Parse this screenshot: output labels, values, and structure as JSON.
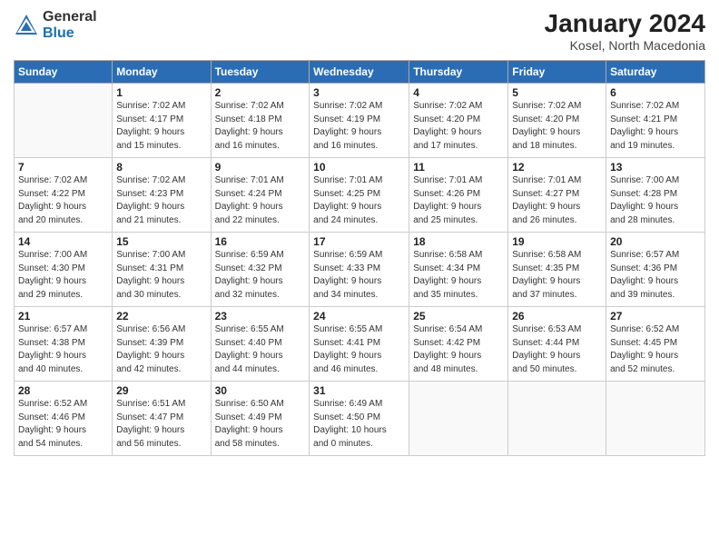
{
  "header": {
    "logo_general": "General",
    "logo_blue": "Blue",
    "month_title": "January 2024",
    "location": "Kosel, North Macedonia"
  },
  "weekdays": [
    "Sunday",
    "Monday",
    "Tuesday",
    "Wednesday",
    "Thursday",
    "Friday",
    "Saturday"
  ],
  "weeks": [
    [
      {
        "day": "",
        "sunrise": "",
        "sunset": "",
        "daylight": ""
      },
      {
        "day": "1",
        "sunrise": "Sunrise: 7:02 AM",
        "sunset": "Sunset: 4:17 PM",
        "daylight": "Daylight: 9 hours and 15 minutes."
      },
      {
        "day": "2",
        "sunrise": "Sunrise: 7:02 AM",
        "sunset": "Sunset: 4:18 PM",
        "daylight": "Daylight: 9 hours and 16 minutes."
      },
      {
        "day": "3",
        "sunrise": "Sunrise: 7:02 AM",
        "sunset": "Sunset: 4:19 PM",
        "daylight": "Daylight: 9 hours and 16 minutes."
      },
      {
        "day": "4",
        "sunrise": "Sunrise: 7:02 AM",
        "sunset": "Sunset: 4:20 PM",
        "daylight": "Daylight: 9 hours and 17 minutes."
      },
      {
        "day": "5",
        "sunrise": "Sunrise: 7:02 AM",
        "sunset": "Sunset: 4:20 PM",
        "daylight": "Daylight: 9 hours and 18 minutes."
      },
      {
        "day": "6",
        "sunrise": "Sunrise: 7:02 AM",
        "sunset": "Sunset: 4:21 PM",
        "daylight": "Daylight: 9 hours and 19 minutes."
      }
    ],
    [
      {
        "day": "7",
        "sunrise": "Sunrise: 7:02 AM",
        "sunset": "Sunset: 4:22 PM",
        "daylight": "Daylight: 9 hours and 20 minutes."
      },
      {
        "day": "8",
        "sunrise": "Sunrise: 7:02 AM",
        "sunset": "Sunset: 4:23 PM",
        "daylight": "Daylight: 9 hours and 21 minutes."
      },
      {
        "day": "9",
        "sunrise": "Sunrise: 7:01 AM",
        "sunset": "Sunset: 4:24 PM",
        "daylight": "Daylight: 9 hours and 22 minutes."
      },
      {
        "day": "10",
        "sunrise": "Sunrise: 7:01 AM",
        "sunset": "Sunset: 4:25 PM",
        "daylight": "Daylight: 9 hours and 24 minutes."
      },
      {
        "day": "11",
        "sunrise": "Sunrise: 7:01 AM",
        "sunset": "Sunset: 4:26 PM",
        "daylight": "Daylight: 9 hours and 25 minutes."
      },
      {
        "day": "12",
        "sunrise": "Sunrise: 7:01 AM",
        "sunset": "Sunset: 4:27 PM",
        "daylight": "Daylight: 9 hours and 26 minutes."
      },
      {
        "day": "13",
        "sunrise": "Sunrise: 7:00 AM",
        "sunset": "Sunset: 4:28 PM",
        "daylight": "Daylight: 9 hours and 28 minutes."
      }
    ],
    [
      {
        "day": "14",
        "sunrise": "Sunrise: 7:00 AM",
        "sunset": "Sunset: 4:30 PM",
        "daylight": "Daylight: 9 hours and 29 minutes."
      },
      {
        "day": "15",
        "sunrise": "Sunrise: 7:00 AM",
        "sunset": "Sunset: 4:31 PM",
        "daylight": "Daylight: 9 hours and 30 minutes."
      },
      {
        "day": "16",
        "sunrise": "Sunrise: 6:59 AM",
        "sunset": "Sunset: 4:32 PM",
        "daylight": "Daylight: 9 hours and 32 minutes."
      },
      {
        "day": "17",
        "sunrise": "Sunrise: 6:59 AM",
        "sunset": "Sunset: 4:33 PM",
        "daylight": "Daylight: 9 hours and 34 minutes."
      },
      {
        "day": "18",
        "sunrise": "Sunrise: 6:58 AM",
        "sunset": "Sunset: 4:34 PM",
        "daylight": "Daylight: 9 hours and 35 minutes."
      },
      {
        "day": "19",
        "sunrise": "Sunrise: 6:58 AM",
        "sunset": "Sunset: 4:35 PM",
        "daylight": "Daylight: 9 hours and 37 minutes."
      },
      {
        "day": "20",
        "sunrise": "Sunrise: 6:57 AM",
        "sunset": "Sunset: 4:36 PM",
        "daylight": "Daylight: 9 hours and 39 minutes."
      }
    ],
    [
      {
        "day": "21",
        "sunrise": "Sunrise: 6:57 AM",
        "sunset": "Sunset: 4:38 PM",
        "daylight": "Daylight: 9 hours and 40 minutes."
      },
      {
        "day": "22",
        "sunrise": "Sunrise: 6:56 AM",
        "sunset": "Sunset: 4:39 PM",
        "daylight": "Daylight: 9 hours and 42 minutes."
      },
      {
        "day": "23",
        "sunrise": "Sunrise: 6:55 AM",
        "sunset": "Sunset: 4:40 PM",
        "daylight": "Daylight: 9 hours and 44 minutes."
      },
      {
        "day": "24",
        "sunrise": "Sunrise: 6:55 AM",
        "sunset": "Sunset: 4:41 PM",
        "daylight": "Daylight: 9 hours and 46 minutes."
      },
      {
        "day": "25",
        "sunrise": "Sunrise: 6:54 AM",
        "sunset": "Sunset: 4:42 PM",
        "daylight": "Daylight: 9 hours and 48 minutes."
      },
      {
        "day": "26",
        "sunrise": "Sunrise: 6:53 AM",
        "sunset": "Sunset: 4:44 PM",
        "daylight": "Daylight: 9 hours and 50 minutes."
      },
      {
        "day": "27",
        "sunrise": "Sunrise: 6:52 AM",
        "sunset": "Sunset: 4:45 PM",
        "daylight": "Daylight: 9 hours and 52 minutes."
      }
    ],
    [
      {
        "day": "28",
        "sunrise": "Sunrise: 6:52 AM",
        "sunset": "Sunset: 4:46 PM",
        "daylight": "Daylight: 9 hours and 54 minutes."
      },
      {
        "day": "29",
        "sunrise": "Sunrise: 6:51 AM",
        "sunset": "Sunset: 4:47 PM",
        "daylight": "Daylight: 9 hours and 56 minutes."
      },
      {
        "day": "30",
        "sunrise": "Sunrise: 6:50 AM",
        "sunset": "Sunset: 4:49 PM",
        "daylight": "Daylight: 9 hours and 58 minutes."
      },
      {
        "day": "31",
        "sunrise": "Sunrise: 6:49 AM",
        "sunset": "Sunset: 4:50 PM",
        "daylight": "Daylight: 10 hours and 0 minutes."
      },
      {
        "day": "",
        "sunrise": "",
        "sunset": "",
        "daylight": ""
      },
      {
        "day": "",
        "sunrise": "",
        "sunset": "",
        "daylight": ""
      },
      {
        "day": "",
        "sunrise": "",
        "sunset": "",
        "daylight": ""
      }
    ]
  ]
}
